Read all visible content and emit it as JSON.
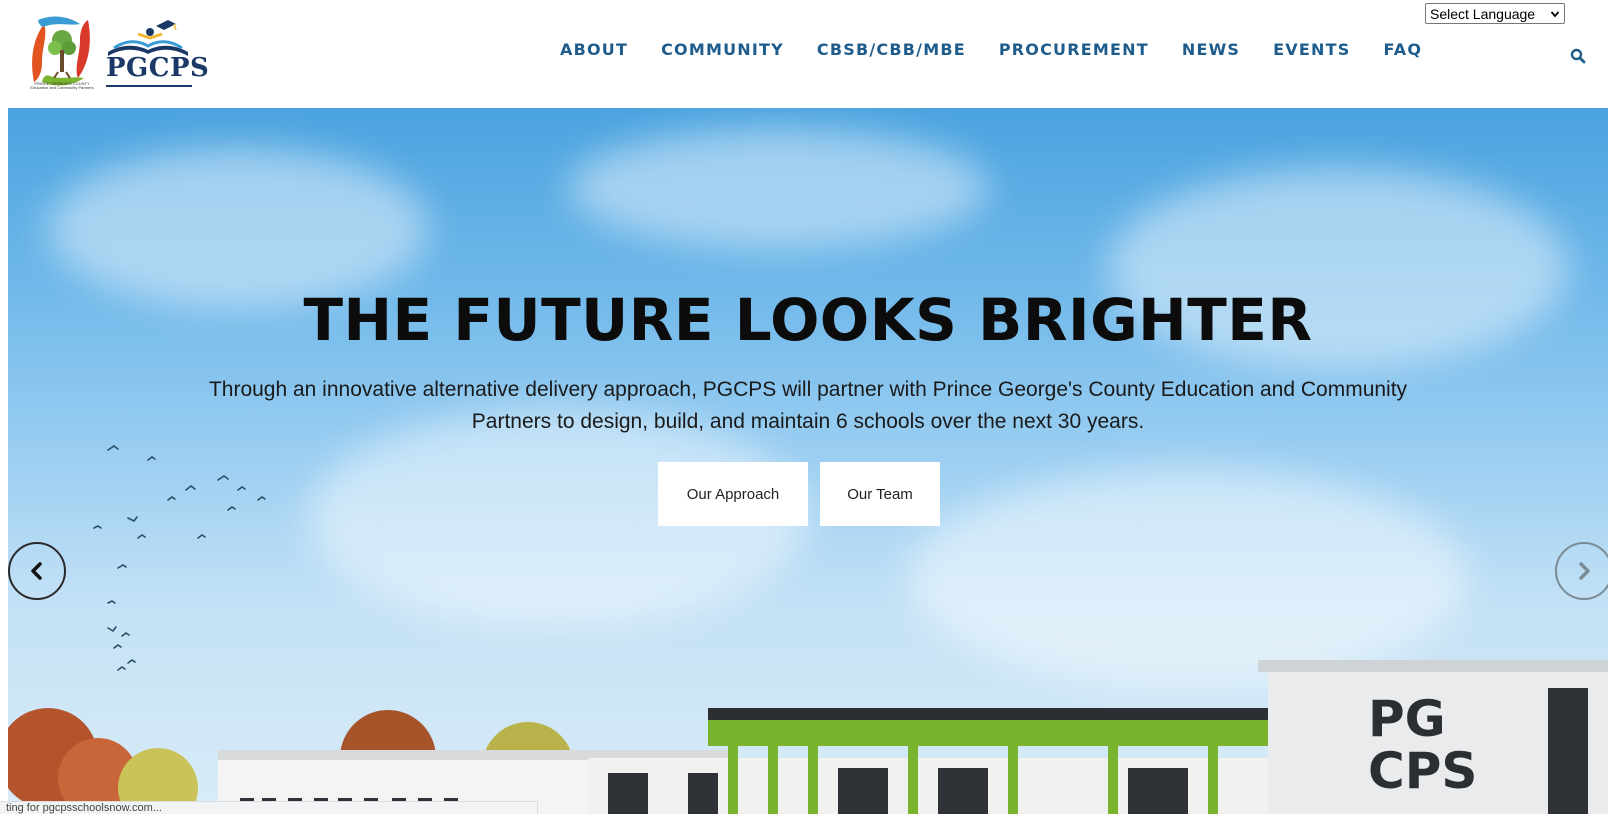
{
  "header": {
    "logo": {
      "text": "PGCPS",
      "caption": "PRINCE GEORGE'S COUNTY Education and Community Partners"
    },
    "nav": [
      {
        "label": "ABOUT"
      },
      {
        "label": "COMMUNITY"
      },
      {
        "label": "CBSB/CBB/MBE"
      },
      {
        "label": "PROCUREMENT"
      },
      {
        "label": "NEWS"
      },
      {
        "label": "EVENTS"
      },
      {
        "label": "FAQ"
      }
    ],
    "language_select": {
      "value": "Select Language"
    },
    "search_icon": "search-icon"
  },
  "hero": {
    "title": "THE FUTURE LOOKS BRIGHTER",
    "subtitle": "Through an innovative alternative delivery approach, PGCPS will partner with Prince George's County Education and Community Partners to design, build, and maintain 6 schools over the next 30 years.",
    "buttons": {
      "approach": "Our Approach",
      "team": "Our Team"
    },
    "building_sign": {
      "line1": "PG",
      "line2": "CPS"
    }
  },
  "status_bar": {
    "text": "ting for pgcpsschoolsnow.com..."
  },
  "colors": {
    "nav": "#1e5c8c",
    "logo_blue": "#1a3966",
    "title": "#0c0c0c",
    "building_green": "#7ab32e"
  }
}
